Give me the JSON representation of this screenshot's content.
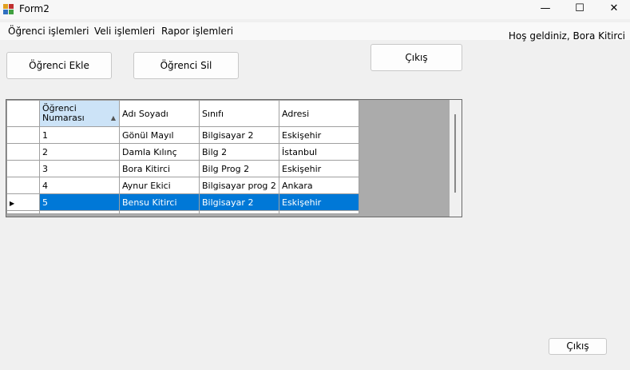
{
  "window": {
    "title": "Form2",
    "minimize_glyph": "—",
    "maximize_glyph": "☐",
    "close_glyph": "✕"
  },
  "menu": {
    "items": [
      "Öğrenci işlemleri",
      "Veli işlemleri",
      "Rapor işlemleri"
    ]
  },
  "welcome_text": "Hoş geldiniz, Bora Kitirci",
  "buttons": {
    "add_student": "Öğrenci Ekle",
    "delete_student": "Öğrenci Sil",
    "exit_top": "Çıkış",
    "exit_bottom": "Çıkış"
  },
  "grid": {
    "columns": [
      "Öğrenci Numarası",
      "Adı Soyadı",
      "Sınıfı",
      "Adresi"
    ],
    "sorted_column": "Öğrenci Numarası",
    "rows": [
      [
        "1",
        "Gönül Mayıl",
        "Bilgisayar 2",
        "Eskişehir"
      ],
      [
        "2",
        "Damla Kılınç",
        "Bilg 2",
        "İstanbul"
      ],
      [
        "3",
        "Bora Kitirci",
        "Bilg Prog 2",
        "Eskişehir"
      ],
      [
        "4",
        "Aynur Ekici",
        "Bilgisayar prog 2",
        "Ankara"
      ],
      [
        "5",
        "Bensu Kitirci",
        "Bilgisayar 2",
        "Eskişehir"
      ]
    ],
    "selected_row": 5,
    "selection_color": "#0078d7"
  }
}
